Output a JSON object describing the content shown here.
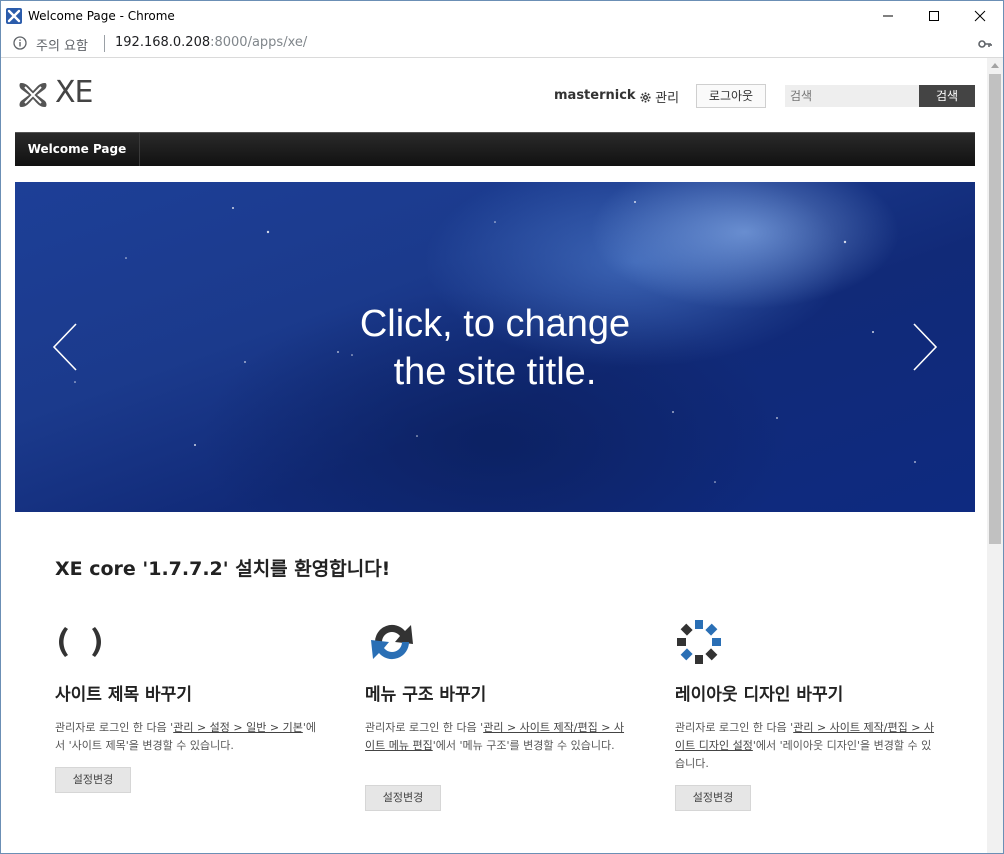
{
  "window": {
    "title": "Welcome Page - Chrome"
  },
  "address_bar": {
    "security_label": "주의 요함",
    "url_host": "192.168.0.208",
    "url_rest": ":8000/apps/xe/"
  },
  "header": {
    "logo_text": "XE",
    "username": "masternick",
    "admin_label": "관리",
    "logout_label": "로그아웃",
    "search_placeholder": "검색",
    "search_button": "검색"
  },
  "nav": {
    "items": [
      {
        "label": "Welcome Page"
      }
    ]
  },
  "hero": {
    "title_line1": "Click, to change",
    "title_line2": "the site title."
  },
  "welcome": {
    "heading": "XE core '1.7.7.2' 설치를 환영합니다!"
  },
  "features": [
    {
      "title": "사이트 제목 바꾸기",
      "desc_prefix": "관리자로 로그인 한 다음 '",
      "desc_link": "관리 > 설정 > 일반 > 기본",
      "desc_suffix": "'에서 '사이트 제목'을 변경할 수 있습니다.",
      "button": "설정변경"
    },
    {
      "title": "메뉴 구조 바꾸기",
      "desc_prefix": "관리자로 로그인 한 다음 '",
      "desc_link": "관리 > 사이트 제작/편집 > 사이트 메뉴 편집",
      "desc_suffix": "'에서 '메뉴 구조'를 변경할 수 있습니다.",
      "button": "설정변경"
    },
    {
      "title": "레이아웃 디자인 바꾸기",
      "desc_prefix": "관리자로 로그인 한 다음 '",
      "desc_link": "관리 > 사이트 제작/편집 > 사이트 디자인 설정",
      "desc_suffix": "'에서 '레이아웃 디자인'을 변경할 수 있습니다.",
      "button": "설정변경"
    }
  ],
  "colors": {
    "nav_bg": "#1a1a1a",
    "hero_blue": "#1b3a8c",
    "icon_blue": "#2a6fb5",
    "icon_dark": "#333333"
  }
}
